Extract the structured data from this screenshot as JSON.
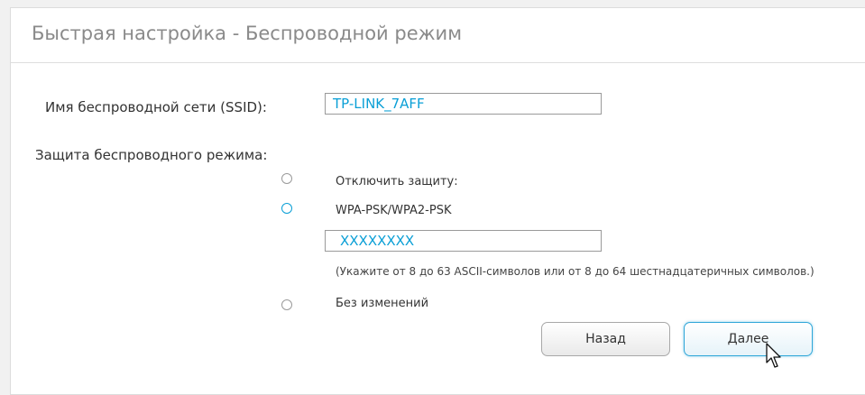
{
  "page": {
    "title": "Быстрая настройка - Беспроводной режим"
  },
  "ssid": {
    "label": "Имя беспроводной сети (SSID):",
    "value": "TP-LINK_7AFF"
  },
  "security": {
    "label": "Защита беспроводного режима:",
    "options": [
      {
        "label": "Отключить защиту:",
        "selected": false
      },
      {
        "label": "WPA-PSK/WPA2-PSK",
        "selected": true
      },
      {
        "label": "Без изменений",
        "selected": false
      }
    ],
    "password_value": "XXXXXXXX",
    "password_hint": "(Укажите от 8 до 63 ASCII-символов или от 8 до 64 шестнадцатеричных символов.)"
  },
  "buttons": {
    "back_label": "Назад",
    "next_label": "Далее"
  },
  "icons": {
    "cursor": "mouse-pointer-icon"
  },
  "colors": {
    "accent": "#0a9fd6",
    "title": "#8a8a8a",
    "text": "#333333"
  }
}
